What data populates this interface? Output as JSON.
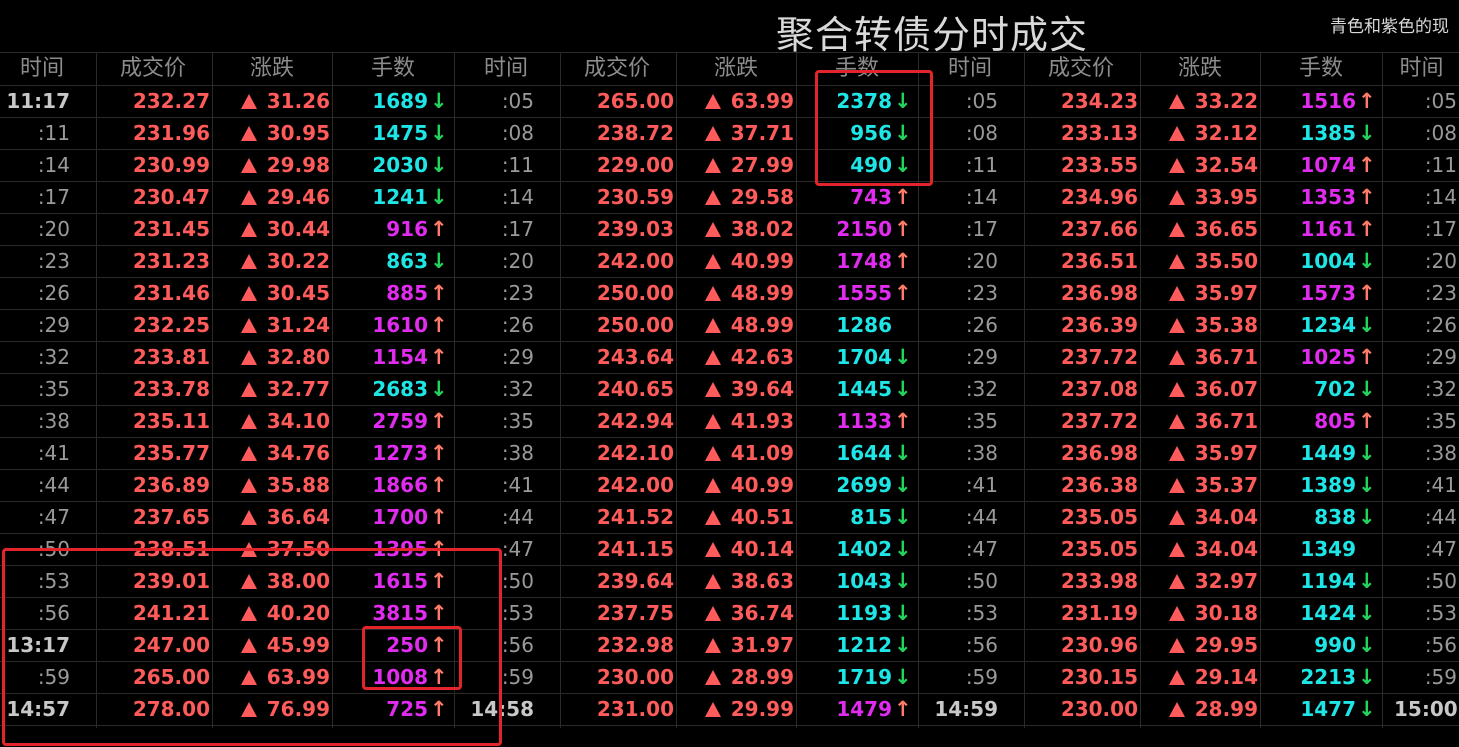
{
  "title": "聚合转债分时成交",
  "note": "青色和紫色的现",
  "colors": {
    "up": "#ff5b5b",
    "cyan": "#1fe6e6",
    "magenta": "#e12cf0",
    "arrow_up": "#ff7a6a",
    "arrow_down": "#22d45a"
  },
  "headers": [
    "时间",
    "成交价",
    "涨跌",
    "手数",
    "时间",
    "成交价",
    "涨跌",
    "手数",
    "时间",
    "成交价",
    "涨跌",
    "手数",
    "时间"
  ],
  "groups": [
    {
      "rows": [
        [
          "11:17",
          "232.27",
          "31.26",
          "1689",
          "c",
          "down"
        ],
        [
          ":11",
          "231.96",
          "30.95",
          "1475",
          "c",
          "down"
        ],
        [
          ":14",
          "230.99",
          "29.98",
          "2030",
          "c",
          "down"
        ],
        [
          ":17",
          "230.47",
          "29.46",
          "1241",
          "c",
          "down"
        ],
        [
          ":20",
          "231.45",
          "30.44",
          "916",
          "m",
          "up"
        ],
        [
          ":23",
          "231.23",
          "30.22",
          "863",
          "c",
          "down"
        ],
        [
          ":26",
          "231.46",
          "30.45",
          "885",
          "m",
          "up"
        ],
        [
          ":29",
          "232.25",
          "31.24",
          "1610",
          "m",
          "up"
        ],
        [
          ":32",
          "233.81",
          "32.80",
          "1154",
          "m",
          "up"
        ],
        [
          ":35",
          "233.78",
          "32.77",
          "2683",
          "c",
          "down"
        ],
        [
          ":38",
          "235.11",
          "34.10",
          "2759",
          "m",
          "up"
        ],
        [
          ":41",
          "235.77",
          "34.76",
          "1273",
          "m",
          "up"
        ],
        [
          ":44",
          "236.89",
          "35.88",
          "1866",
          "m",
          "up"
        ],
        [
          ":47",
          "237.65",
          "36.64",
          "1700",
          "m",
          "up"
        ],
        [
          ":50",
          "238.51",
          "37.50",
          "1395",
          "m",
          "up"
        ],
        [
          ":53",
          "239.01",
          "38.00",
          "1615",
          "m",
          "up"
        ],
        [
          ":56",
          "241.21",
          "40.20",
          "3815",
          "m",
          "up"
        ],
        [
          "13:17",
          "247.00",
          "45.99",
          "250",
          "m",
          "up"
        ],
        [
          ":59",
          "265.00",
          "63.99",
          "1008",
          "m",
          "up"
        ],
        [
          "14:57",
          "278.00",
          "76.99",
          "725",
          "m",
          "up"
        ]
      ]
    },
    {
      "rows": [
        [
          ":05",
          "265.00",
          "63.99",
          "2378",
          "c",
          "down"
        ],
        [
          ":08",
          "238.72",
          "37.71",
          "956",
          "c",
          "down"
        ],
        [
          ":11",
          "229.00",
          "27.99",
          "490",
          "c",
          "down"
        ],
        [
          ":14",
          "230.59",
          "29.58",
          "743",
          "m",
          "up"
        ],
        [
          ":17",
          "239.03",
          "38.02",
          "2150",
          "m",
          "up"
        ],
        [
          ":20",
          "242.00",
          "40.99",
          "1748",
          "m",
          "up"
        ],
        [
          ":23",
          "250.00",
          "48.99",
          "1555",
          "m",
          "up"
        ],
        [
          ":26",
          "250.00",
          "48.99",
          "1286",
          "c",
          "none"
        ],
        [
          ":29",
          "243.64",
          "42.63",
          "1704",
          "c",
          "down"
        ],
        [
          ":32",
          "240.65",
          "39.64",
          "1445",
          "c",
          "down"
        ],
        [
          ":35",
          "242.94",
          "41.93",
          "1133",
          "m",
          "up"
        ],
        [
          ":38",
          "242.10",
          "41.09",
          "1644",
          "c",
          "down"
        ],
        [
          ":41",
          "242.00",
          "40.99",
          "2699",
          "c",
          "down"
        ],
        [
          ":44",
          "241.52",
          "40.51",
          "815",
          "c",
          "down"
        ],
        [
          ":47",
          "241.15",
          "40.14",
          "1402",
          "c",
          "down"
        ],
        [
          ":50",
          "239.64",
          "38.63",
          "1043",
          "c",
          "down"
        ],
        [
          ":53",
          "237.75",
          "36.74",
          "1193",
          "c",
          "down"
        ],
        [
          ":56",
          "232.98",
          "31.97",
          "1212",
          "c",
          "down"
        ],
        [
          ":59",
          "230.00",
          "28.99",
          "1719",
          "c",
          "down"
        ],
        [
          "14:58",
          "231.00",
          "29.99",
          "1479",
          "m",
          "up"
        ]
      ]
    },
    {
      "rows": [
        [
          ":05",
          "234.23",
          "33.22",
          "1516",
          "m",
          "up"
        ],
        [
          ":08",
          "233.13",
          "32.12",
          "1385",
          "c",
          "down"
        ],
        [
          ":11",
          "233.55",
          "32.54",
          "1074",
          "m",
          "up"
        ],
        [
          ":14",
          "234.96",
          "33.95",
          "1353",
          "m",
          "up"
        ],
        [
          ":17",
          "237.66",
          "36.65",
          "1161",
          "m",
          "up"
        ],
        [
          ":20",
          "236.51",
          "35.50",
          "1004",
          "c",
          "down"
        ],
        [
          ":23",
          "236.98",
          "35.97",
          "1573",
          "m",
          "up"
        ],
        [
          ":26",
          "236.39",
          "35.38",
          "1234",
          "c",
          "down"
        ],
        [
          ":29",
          "237.72",
          "36.71",
          "1025",
          "m",
          "up"
        ],
        [
          ":32",
          "237.08",
          "36.07",
          "702",
          "c",
          "down"
        ],
        [
          ":35",
          "237.72",
          "36.71",
          "805",
          "m",
          "up"
        ],
        [
          ":38",
          "236.98",
          "35.97",
          "1449",
          "c",
          "down"
        ],
        [
          ":41",
          "236.38",
          "35.37",
          "1389",
          "c",
          "down"
        ],
        [
          ":44",
          "235.05",
          "34.04",
          "838",
          "c",
          "down"
        ],
        [
          ":47",
          "235.05",
          "34.04",
          "1349",
          "c",
          "none"
        ],
        [
          ":50",
          "233.98",
          "32.97",
          "1194",
          "c",
          "down"
        ],
        [
          ":53",
          "231.19",
          "30.18",
          "1424",
          "c",
          "down"
        ],
        [
          ":56",
          "230.96",
          "29.95",
          "990",
          "c",
          "down"
        ],
        [
          ":59",
          "230.15",
          "29.14",
          "2213",
          "c",
          "down"
        ],
        [
          "14:59",
          "230.00",
          "28.99",
          "1477",
          "c",
          "down"
        ]
      ]
    },
    {
      "rows": [
        [
          ":05"
        ],
        [
          ":08"
        ],
        [
          ":11"
        ],
        [
          ":14"
        ],
        [
          ":17"
        ],
        [
          ":20"
        ],
        [
          ":23"
        ],
        [
          ":26"
        ],
        [
          ":29"
        ],
        [
          ":32"
        ],
        [
          ":35"
        ],
        [
          ":38"
        ],
        [
          ":41"
        ],
        [
          ":44"
        ],
        [
          ":47"
        ],
        [
          ":50"
        ],
        [
          ":53"
        ],
        [
          ":56"
        ],
        [
          ":59"
        ],
        [
          "15:00"
        ]
      ]
    }
  ]
}
